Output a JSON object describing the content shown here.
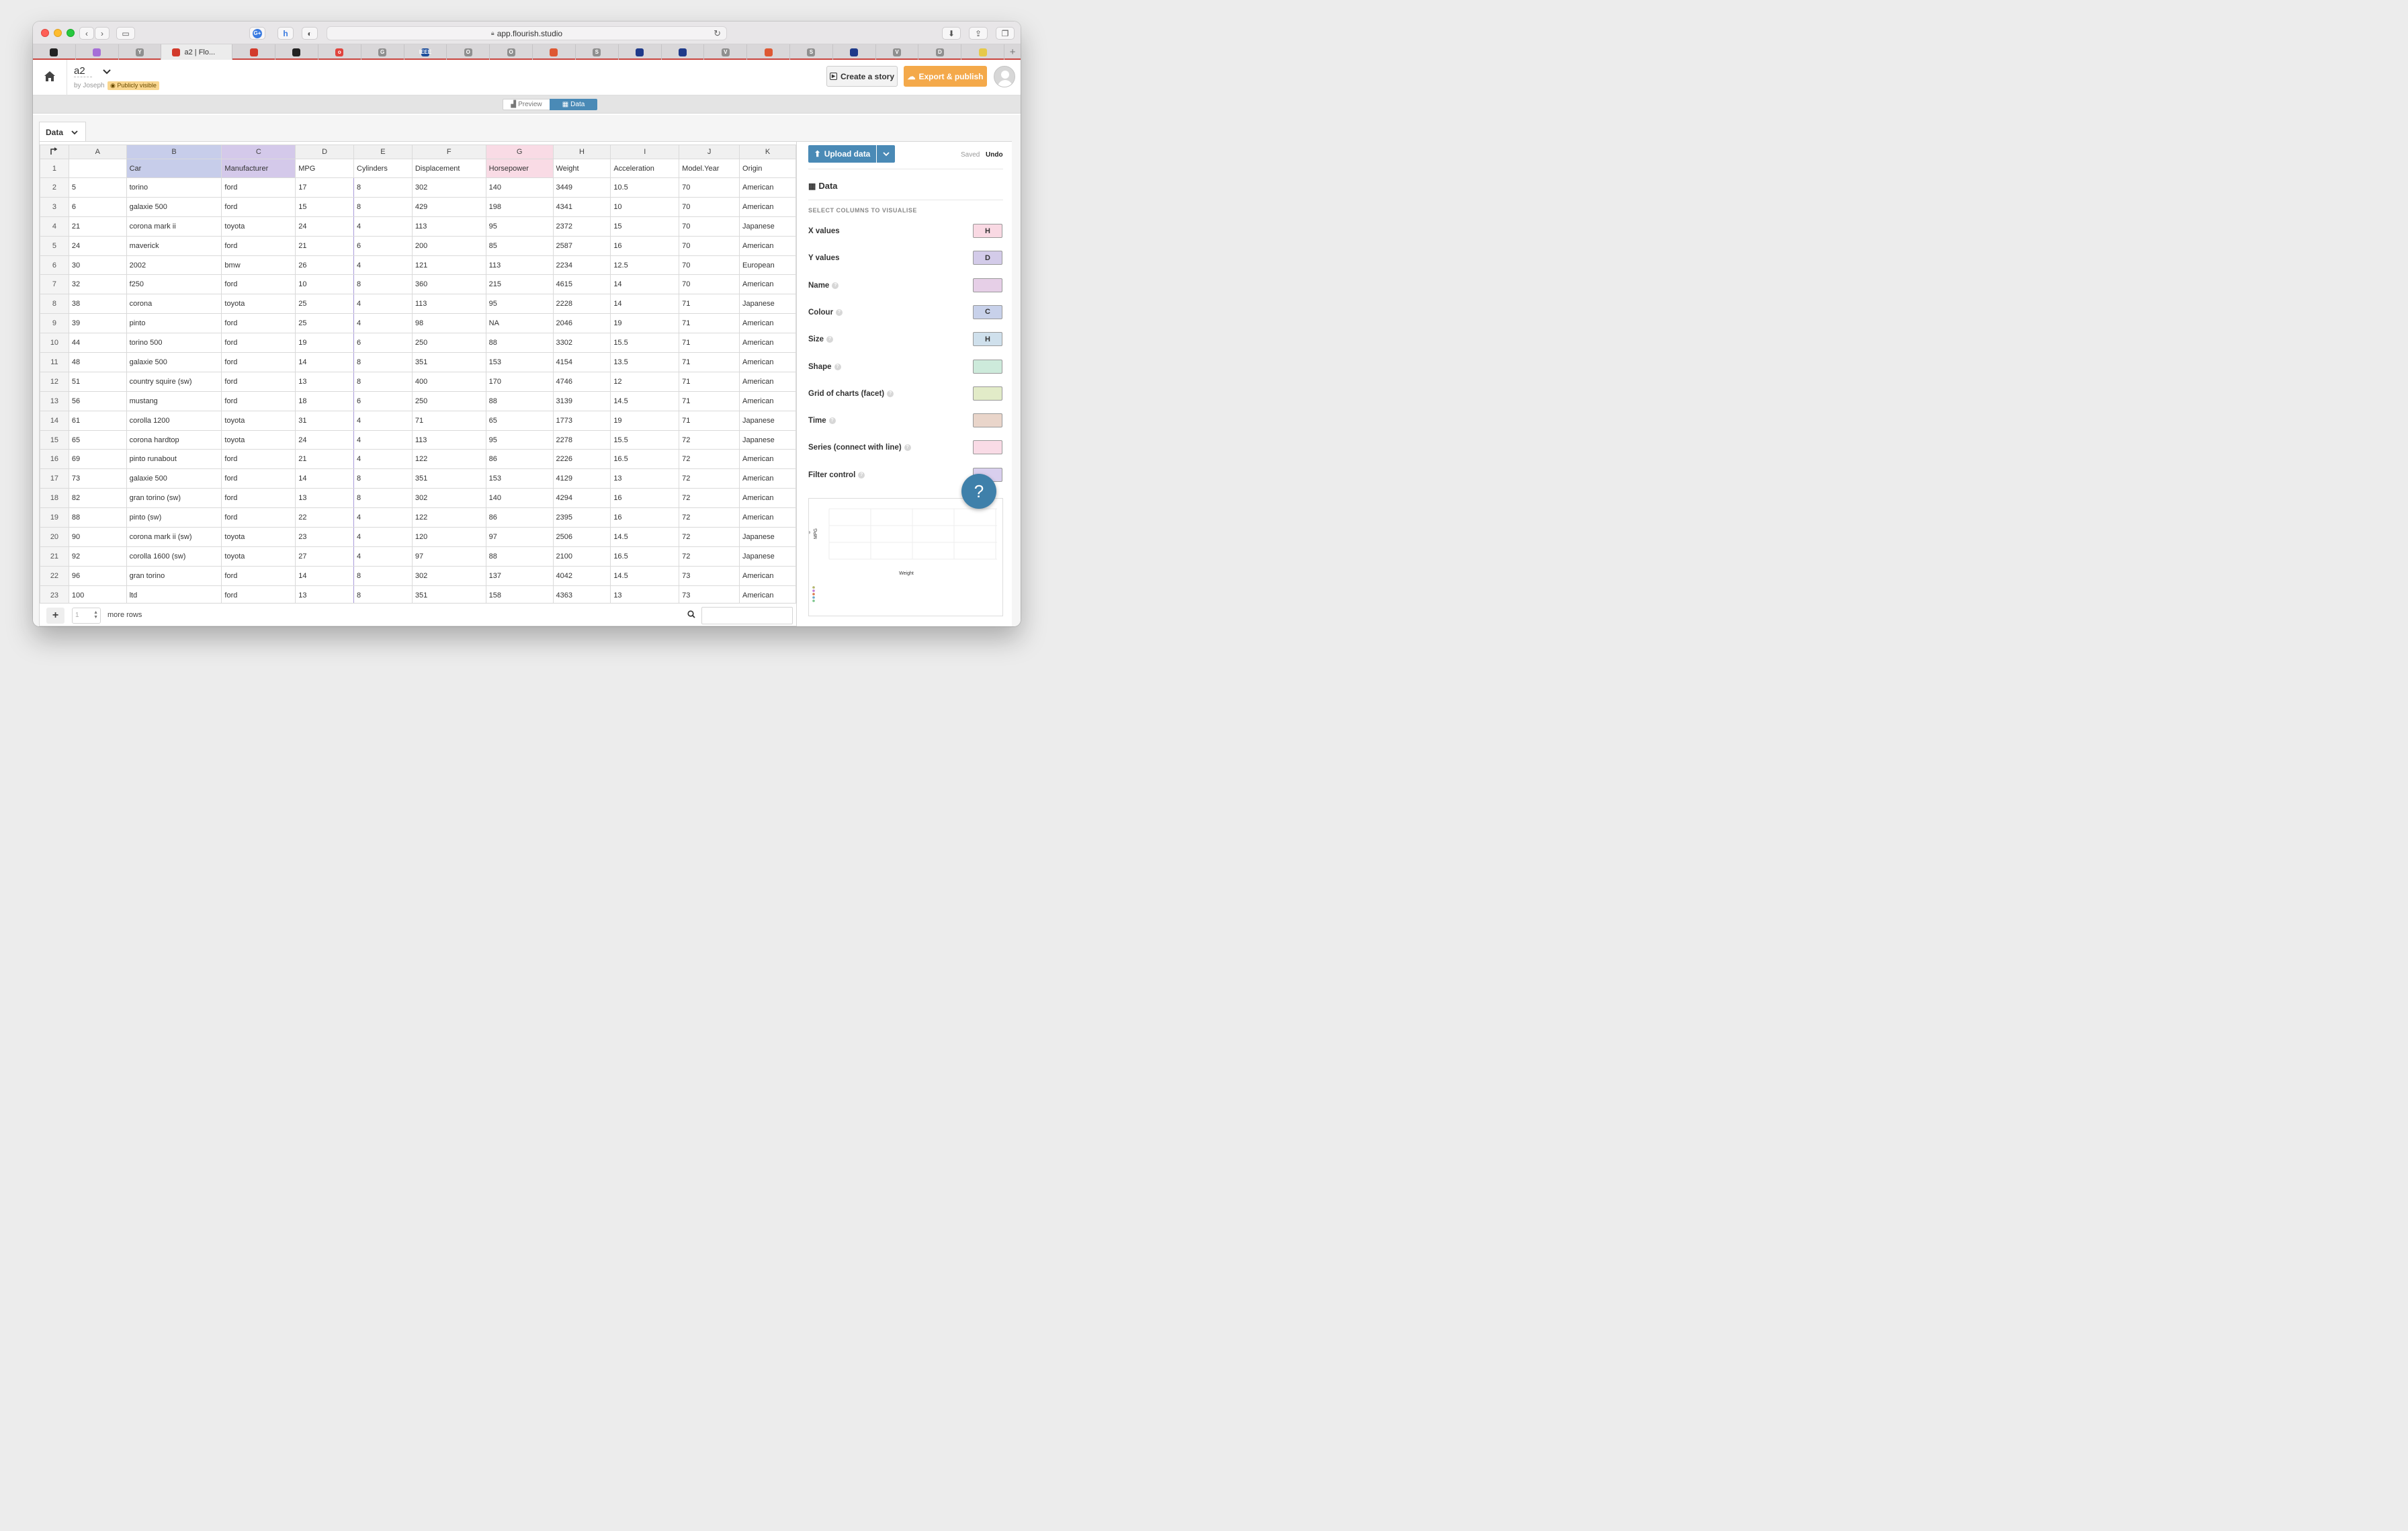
{
  "browser": {
    "url": "app.flourish.studio",
    "tabs": [
      {
        "icon": "github-icon",
        "color": "#222222",
        "glyph": ""
      },
      {
        "icon": "sparkle-icon",
        "color": "#a66fd8",
        "glyph": ""
      },
      {
        "icon": "y-icon",
        "color": "#8f8f8f",
        "glyph": "Y"
      },
      {
        "icon": "flourish-icon",
        "color": "#d23a2b",
        "glyph": "",
        "label": "a2 | Flo...",
        "active": true
      },
      {
        "icon": "flourish-icon",
        "color": "#d23a2b",
        "glyph": ""
      },
      {
        "icon": "github-icon",
        "color": "#222222",
        "glyph": ""
      },
      {
        "icon": "o-icon",
        "color": "#e0443e",
        "glyph": "o"
      },
      {
        "icon": "g-icon",
        "color": "#8f8f8f",
        "glyph": "G"
      },
      {
        "icon": "ieee-icon",
        "color": "#1d4e9c",
        "glyph": "IEEE"
      },
      {
        "icon": "o-icon",
        "color": "#8f8f8f",
        "glyph": "O"
      },
      {
        "icon": "o-icon",
        "color": "#8f8f8f",
        "glyph": "O"
      },
      {
        "icon": "duck-icon",
        "color": "#de5833",
        "glyph": ""
      },
      {
        "icon": "s-icon",
        "color": "#8f8f8f",
        "glyph": "S"
      },
      {
        "icon": "star-icon",
        "color": "#1f3a8a",
        "glyph": ""
      },
      {
        "icon": "star-icon",
        "color": "#1f3a8a",
        "glyph": ""
      },
      {
        "icon": "v-icon",
        "color": "#8f8f8f",
        "glyph": "V"
      },
      {
        "icon": "duck-icon",
        "color": "#de5833",
        "glyph": ""
      },
      {
        "icon": "s-icon",
        "color": "#8f8f8f",
        "glyph": "S"
      },
      {
        "icon": "star-icon",
        "color": "#1f3a8a",
        "glyph": ""
      },
      {
        "icon": "v-icon",
        "color": "#8f8f8f",
        "glyph": "V"
      },
      {
        "icon": "d-icon",
        "color": "#8f8f8f",
        "glyph": "D"
      },
      {
        "icon": "photo-icon",
        "color": "#e6c94a",
        "glyph": ""
      }
    ]
  },
  "header": {
    "project_title": "a2",
    "byline": "by Joseph",
    "visibility": "Publicly visible",
    "create_story": "Create a story",
    "export_publish": "Export & publish"
  },
  "modes": {
    "preview": "Preview",
    "data": "Data"
  },
  "sheet_tab": "Data",
  "grid": {
    "columns": [
      "A",
      "B",
      "C",
      "D",
      "E",
      "F",
      "G",
      "H",
      "I",
      "J",
      "K"
    ],
    "header_row": [
      "",
      "Car",
      "Manufacturer",
      "MPG",
      "Cylinders",
      "Displacement",
      "Horsepower",
      "Weight",
      "Acceleration",
      "Model.Year",
      "Origin"
    ],
    "rows": [
      [
        "5",
        "torino",
        "ford",
        "17",
        "8",
        "302",
        "140",
        "3449",
        "10.5",
        "70",
        "American"
      ],
      [
        "6",
        "galaxie 500",
        "ford",
        "15",
        "8",
        "429",
        "198",
        "4341",
        "10",
        "70",
        "American"
      ],
      [
        "21",
        "corona mark ii",
        "toyota",
        "24",
        "4",
        "113",
        "95",
        "2372",
        "15",
        "70",
        "Japanese"
      ],
      [
        "24",
        "maverick",
        "ford",
        "21",
        "6",
        "200",
        "85",
        "2587",
        "16",
        "70",
        "American"
      ],
      [
        "30",
        "2002",
        "bmw",
        "26",
        "4",
        "121",
        "113",
        "2234",
        "12.5",
        "70",
        "European"
      ],
      [
        "32",
        "f250",
        "ford",
        "10",
        "8",
        "360",
        "215",
        "4615",
        "14",
        "70",
        "American"
      ],
      [
        "38",
        "corona",
        "toyota",
        "25",
        "4",
        "113",
        "95",
        "2228",
        "14",
        "71",
        "Japanese"
      ],
      [
        "39",
        "pinto",
        "ford",
        "25",
        "4",
        "98",
        "NA",
        "2046",
        "19",
        "71",
        "American"
      ],
      [
        "44",
        "torino 500",
        "ford",
        "19",
        "6",
        "250",
        "88",
        "3302",
        "15.5",
        "71",
        "American"
      ],
      [
        "48",
        "galaxie 500",
        "ford",
        "14",
        "8",
        "351",
        "153",
        "4154",
        "13.5",
        "71",
        "American"
      ],
      [
        "51",
        "country squire (sw)",
        "ford",
        "13",
        "8",
        "400",
        "170",
        "4746",
        "12",
        "71",
        "American"
      ],
      [
        "56",
        "mustang",
        "ford",
        "18",
        "6",
        "250",
        "88",
        "3139",
        "14.5",
        "71",
        "American"
      ],
      [
        "61",
        "corolla 1200",
        "toyota",
        "31",
        "4",
        "71",
        "65",
        "1773",
        "19",
        "71",
        "Japanese"
      ],
      [
        "65",
        "corona hardtop",
        "toyota",
        "24",
        "4",
        "113",
        "95",
        "2278",
        "15.5",
        "72",
        "Japanese"
      ],
      [
        "69",
        "pinto runabout",
        "ford",
        "21",
        "4",
        "122",
        "86",
        "2226",
        "16.5",
        "72",
        "American"
      ],
      [
        "73",
        "galaxie 500",
        "ford",
        "14",
        "8",
        "351",
        "153",
        "4129",
        "13",
        "72",
        "American"
      ],
      [
        "82",
        "gran torino (sw)",
        "ford",
        "13",
        "8",
        "302",
        "140",
        "4294",
        "16",
        "72",
        "American"
      ],
      [
        "88",
        "pinto (sw)",
        "ford",
        "22",
        "4",
        "122",
        "86",
        "2395",
        "16",
        "72",
        "American"
      ],
      [
        "90",
        "corona mark ii (sw)",
        "toyota",
        "23",
        "4",
        "120",
        "97",
        "2506",
        "14.5",
        "72",
        "Japanese"
      ],
      [
        "92",
        "corolla 1600 (sw)",
        "toyota",
        "27",
        "4",
        "97",
        "88",
        "2100",
        "16.5",
        "72",
        "Japanese"
      ],
      [
        "96",
        "gran torino",
        "ford",
        "14",
        "8",
        "302",
        "137",
        "4042",
        "14.5",
        "73",
        "American"
      ],
      [
        "100",
        "ltd",
        "ford",
        "13",
        "8",
        "351",
        "158",
        "4363",
        "13",
        "73",
        "American"
      ]
    ],
    "more_rows_value": "1",
    "more_rows_label": "more rows"
  },
  "panel": {
    "upload": "Upload data",
    "saved": "Saved",
    "undo": "Undo",
    "title": "Data",
    "subtitle": "SELECT COLUMNS TO VISUALISE",
    "bindings": [
      {
        "label": "X values",
        "value": "H",
        "color": "#f9d9e3",
        "help": false
      },
      {
        "label": "Y values",
        "value": "D",
        "color": "#d3cbe9",
        "help": false
      },
      {
        "label": "Name",
        "value": "",
        "color": "#e6cfe7",
        "help": true
      },
      {
        "label": "Colour",
        "value": "C",
        "color": "#c8d1ea",
        "help": true
      },
      {
        "label": "Size",
        "value": "H",
        "color": "#cfe0ec",
        "help": true
      },
      {
        "label": "Shape",
        "value": "",
        "color": "#cdeadb",
        "help": true
      },
      {
        "label": "Grid of charts (facet)",
        "value": "",
        "color": "#e2ebc8",
        "help": true
      },
      {
        "label": "Time",
        "value": "",
        "color": "#e9d5ca",
        "help": true
      },
      {
        "label": "Series (connect with line)",
        "value": "",
        "color": "#f9dbe6",
        "help": true
      },
      {
        "label": "Filter control",
        "value": "",
        "color": "#d9cfee",
        "help": true
      }
    ],
    "help_fab": "?"
  },
  "colors": {
    "col_c": "#c7cdea",
    "col_d": "#d4c9ea",
    "col_h": "#f9dbe5",
    "accent_blue": "#4a8ab6",
    "export_orange": "#f4a94a"
  }
}
